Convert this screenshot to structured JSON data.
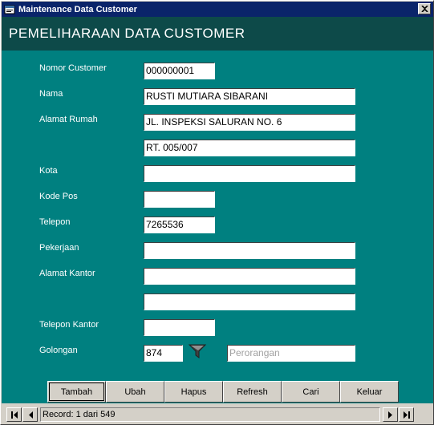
{
  "window": {
    "title": "Maintenance Data Customer"
  },
  "header": {
    "title": "PEMELIHARAAN DATA CUSTOMER"
  },
  "fields": {
    "nomor_customer": {
      "label": "Nomor Customer",
      "value": "000000001"
    },
    "nama": {
      "label": "Nama",
      "value": "RUSTI MUTIARA SIBARANI"
    },
    "alamat_rumah": {
      "label": "Alamat Rumah",
      "value": "JL. INSPEKSI SALURAN NO. 6",
      "value2": "RT. 005/007"
    },
    "kota": {
      "label": "Kota",
      "value": ""
    },
    "kode_pos": {
      "label": "Kode Pos",
      "value": ""
    },
    "telepon": {
      "label": "Telepon",
      "value": "7265536"
    },
    "pekerjaan": {
      "label": "Pekerjaan",
      "value": ""
    },
    "alamat_kantor": {
      "label": "Alamat Kantor",
      "value": "",
      "value2": ""
    },
    "telepon_kantor": {
      "label": "Telepon Kantor",
      "value": ""
    },
    "golongan": {
      "label": "Golongan",
      "value": "874",
      "description": "Perorangan"
    }
  },
  "buttons": {
    "tambah": "Tambah",
    "ubah": "Ubah",
    "hapus": "Hapus",
    "refresh": "Refresh",
    "cari": "Cari",
    "keluar": "Keluar"
  },
  "navigator": {
    "caption": "Record: 1 dari 549"
  },
  "colors": {
    "form_bg": "#008080",
    "header_bg": "#0d4a49",
    "titlebar_bg": "#0a246a"
  },
  "icons": {
    "app": "app-window-icon",
    "close": "close-icon",
    "dropdown": "funnel-dropdown-icon",
    "first": "first-record-icon",
    "prev": "previous-record-icon",
    "next": "next-record-icon",
    "last": "last-record-icon"
  }
}
